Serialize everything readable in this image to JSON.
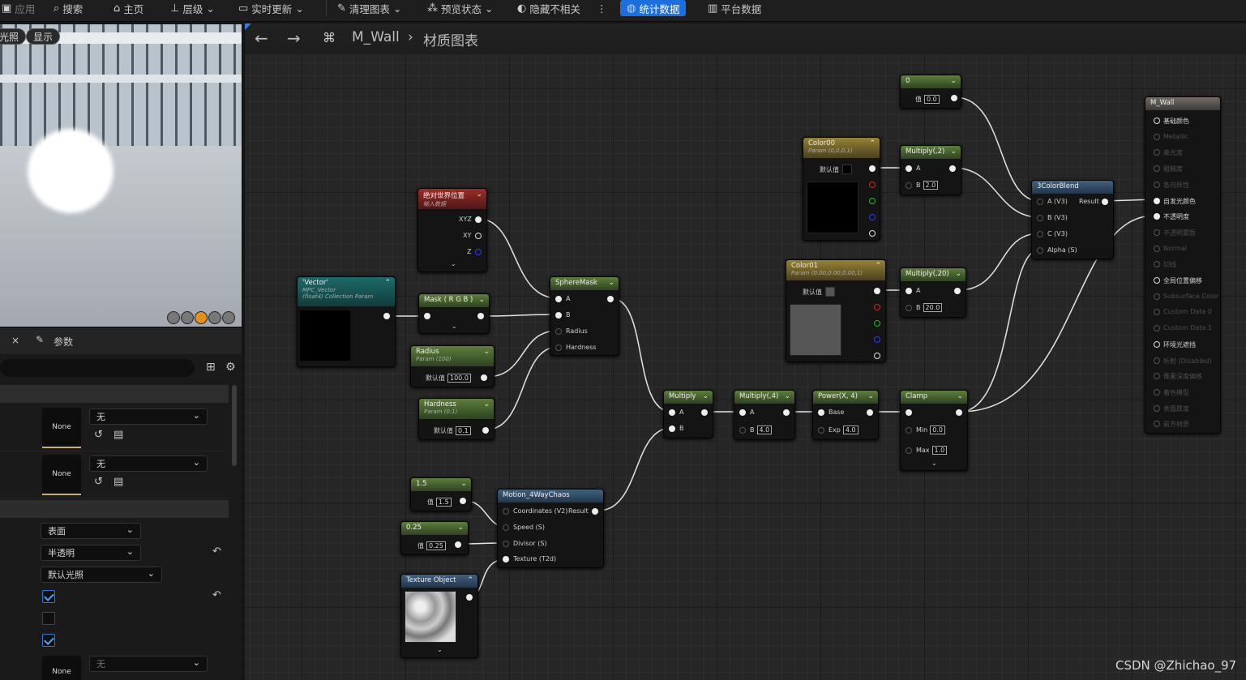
{
  "toolbar": {
    "items": [
      {
        "label": "应用",
        "icon": "apply-icon"
      },
      {
        "label": "搜索",
        "icon": "search-icon"
      },
      {
        "label": "主页",
        "icon": "home-icon"
      },
      {
        "label": "层级",
        "icon": "hierarchy-icon"
      },
      {
        "label": "实时更新",
        "icon": "live-update-icon"
      },
      {
        "label": "清理图表",
        "icon": "clean-graph-icon"
      },
      {
        "label": "预览状态",
        "icon": "preview-state-icon"
      },
      {
        "label": "隐藏不相关",
        "icon": "hide-unrelated-icon"
      },
      {
        "label": "统计数据",
        "icon": "stats-icon"
      },
      {
        "label": "平台数据",
        "icon": "platform-icon"
      }
    ],
    "more": "⋮"
  },
  "viewport": {
    "btn_lit": "光照",
    "btn_show": "显示"
  },
  "details": {
    "tab_close": "×",
    "tab_label": "参数",
    "rows": {
      "thumb1": "None",
      "dd1": "无",
      "thumb2": "None",
      "dd2": "无",
      "domain": "表面",
      "blend": "半透明",
      "shading": "默认光照",
      "thumb3": "None",
      "dd3": "无"
    }
  },
  "graph": {
    "asset": "M_Wall",
    "sep": "›",
    "view": "材质图表"
  },
  "nodes": {
    "c0": {
      "title": "0",
      "field": "值",
      "value": "0.0"
    },
    "color00": {
      "title": "Color00",
      "sub": "Param (0,0,0,1)",
      "field": "默认值"
    },
    "mul2": {
      "title": "Multiply(,2)",
      "a": "A",
      "b": "B",
      "bval": "2.0"
    },
    "blend": {
      "title": "3ColorBlend",
      "a": "A (V3)",
      "b": "B (V3)",
      "c": "C (V3)",
      "alpha": "Alpha (S)",
      "result": "Result"
    },
    "abs": {
      "title": "绝对世界位置",
      "sub": "输入数据",
      "p1": "XYZ",
      "p2": "XY",
      "p3": "Z"
    },
    "vector": {
      "title": "'Vector'",
      "sub1": "MPC_Vector",
      "sub2": "(float4) Collection Param"
    },
    "mask": {
      "title": "Mask ( R G B )"
    },
    "sphere": {
      "title": "SphereMask",
      "a": "A",
      "b": "B",
      "r": "Radius",
      "h": "Hardness"
    },
    "radius": {
      "title": "Radius",
      "sub": "Param (100)",
      "field": "默认值",
      "value": "100.0"
    },
    "hard": {
      "title": "Hardness",
      "sub": "Param (0.1)",
      "field": "默认值",
      "value": "0.1"
    },
    "color01": {
      "title": "Color01",
      "sub": "Param (0.00,0.00,0.00,1)",
      "field": "默认值"
    },
    "mul20": {
      "title": "Multiply(,20)",
      "a": "A",
      "b": "B",
      "bval": "20.0"
    },
    "mul": {
      "title": "Multiply",
      "a": "A",
      "b": "B"
    },
    "mul4": {
      "title": "Multiply(,4)",
      "a": "A",
      "b": "B",
      "bval": "4.0"
    },
    "pow": {
      "title": "Power(X, 4)",
      "a": "Base",
      "b": "Exp",
      "bval": "4.0"
    },
    "clamp": {
      "title": "Clamp",
      "min": "Min",
      "minv": "0.0",
      "max": "Max",
      "maxv": "1.0"
    },
    "c15": {
      "title": "1.5",
      "field": "值",
      "value": "1.5"
    },
    "c025": {
      "title": "0.25",
      "field": "值",
      "value": "0.25"
    },
    "motion": {
      "title": "Motion_4WayChaos",
      "p1": "Coordinates (V2)",
      "p2": "Speed (S)",
      "p3": "Divisor (S)",
      "p4": "Texture (T2d)",
      "result": "Result"
    },
    "tex": {
      "title": "Texture Object"
    }
  },
  "result": {
    "title": "M_Wall",
    "outputs": [
      {
        "label": "基础颜色",
        "enabled": true
      },
      {
        "label": "Metallic",
        "enabled": false
      },
      {
        "label": "高光度",
        "enabled": false
      },
      {
        "label": "粗糙度",
        "enabled": false
      },
      {
        "label": "各向异性",
        "enabled": false
      },
      {
        "label": "自发光颜色",
        "enabled": true
      },
      {
        "label": "不透明度",
        "enabled": true
      },
      {
        "label": "不透明蒙版",
        "enabled": false
      },
      {
        "label": "Normal",
        "enabled": false
      },
      {
        "label": "切线",
        "enabled": false
      },
      {
        "label": "全局位置偏移",
        "enabled": true
      },
      {
        "label": "Subsurface Color",
        "enabled": false
      },
      {
        "label": "Custom Data 0",
        "enabled": false
      },
      {
        "label": "Custom Data 1",
        "enabled": false
      },
      {
        "label": "环境光遮挡",
        "enabled": true
      },
      {
        "label": "折射 (Disabled)",
        "enabled": false
      },
      {
        "label": "像素深度偏移",
        "enabled": false
      },
      {
        "label": "着色模型",
        "enabled": false
      },
      {
        "label": "表面厚度",
        "enabled": false
      },
      {
        "label": "前方材质",
        "enabled": false
      }
    ]
  },
  "watermark": "CSDN @Zhichao_97",
  "colors": {
    "accent": "#1c6fdd",
    "scalar_header": "#5d7f3a",
    "vector_header": "#958232",
    "function_header": "#416180",
    "pin_red": "#e02020",
    "pin_green": "#20c020",
    "pin_blue": "#2040ff"
  }
}
